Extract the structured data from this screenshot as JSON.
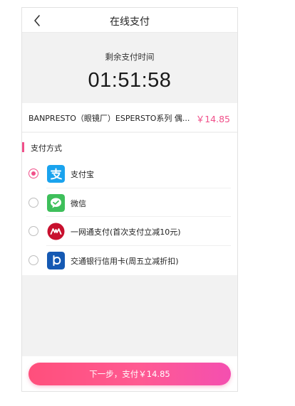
{
  "navbar": {
    "title": "在线支付",
    "back_icon": "chevron-left-icon"
  },
  "timer": {
    "label": "剩余支付时间",
    "value": "01:51:58"
  },
  "order": {
    "name": "BANPRESTO（眼镜厂）ESPERSTO系列 偶...",
    "price": "￥14.85"
  },
  "payment": {
    "section_title": "支付方式",
    "selected_index": 0,
    "methods": [
      {
        "label": "支付宝",
        "icon": "alipay-icon",
        "color": "#1aa3ee"
      },
      {
        "label": "微信",
        "icon": "wechat-icon",
        "color": "#3ebf5b"
      },
      {
        "label": "一网通支付(首次支付立减10元)",
        "icon": "cmb-icon",
        "color": "#c8102e"
      },
      {
        "label": "交通银行信用卡(周五立减折扣)",
        "icon": "bocom-icon",
        "color": "#1559b3"
      }
    ]
  },
  "footer": {
    "next_button_label": "下一步，支付￥14.85"
  },
  "colors": {
    "accent": "#f0508a",
    "background": "#f2f2f2"
  }
}
